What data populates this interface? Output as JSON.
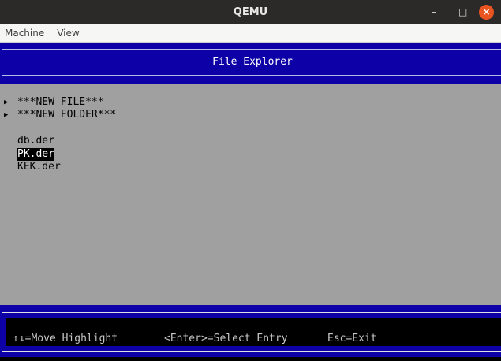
{
  "window": {
    "title": "QEMU",
    "minimize": "–",
    "maximize": "□",
    "close": "×"
  },
  "menu": [
    "Machine",
    "View"
  ],
  "header": {
    "title": "File Explorer"
  },
  "entries": [
    {
      "label": "***NEW FILE***",
      "arrow": "▶"
    },
    {
      "label": "***NEW FOLDER***",
      "arrow": "▶"
    }
  ],
  "files": [
    {
      "label": "db.der",
      "selected": false
    },
    {
      "label": "PK.der",
      "selected": true
    },
    {
      "label": "KEK.der",
      "selected": false
    }
  ],
  "footer": {
    "move": "↑↓=Move Highlight",
    "select": "<Enter>=Select Entry",
    "exit": "Esc=Exit"
  }
}
